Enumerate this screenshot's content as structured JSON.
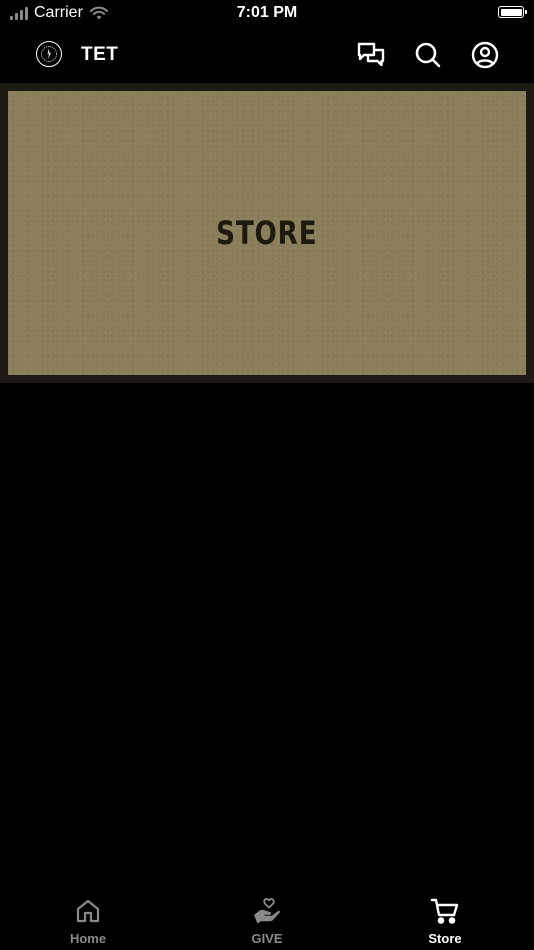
{
  "status_bar": {
    "carrier": "Carrier",
    "time": "7:01 PM"
  },
  "header": {
    "title": "TET",
    "icons": [
      "chat-icon",
      "search-icon",
      "account-icon"
    ]
  },
  "banner": {
    "title": "STORE",
    "background_color": "#8b7e5b",
    "text_color": "#1d1a0f"
  },
  "tab_bar": {
    "tabs": [
      {
        "label": "Home",
        "icon": "home-icon",
        "active": false
      },
      {
        "label": "GIVE",
        "icon": "give-icon",
        "active": false
      },
      {
        "label": "Store",
        "icon": "cart-icon",
        "active": true
      }
    ],
    "active_color": "#ffffff",
    "inactive_color": "#8a8a8a"
  }
}
